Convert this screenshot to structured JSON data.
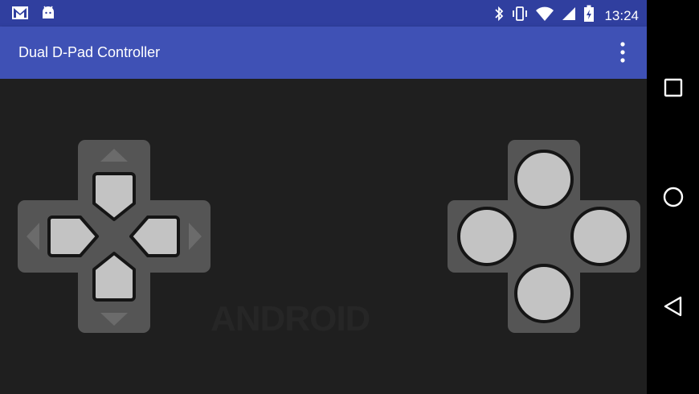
{
  "status_bar": {
    "left_icons": [
      "gmail-icon",
      "android-icon"
    ],
    "right_icons": [
      "bluetooth-icon",
      "vibrate-icon",
      "wifi-icon",
      "cell-signal-icon",
      "battery-charging-icon"
    ],
    "time": "13:24"
  },
  "app_bar": {
    "title": "Dual D-Pad Controller",
    "menu_icon": "overflow-menu-icon",
    "color": "#3f51b5",
    "status_color": "#303f9f"
  },
  "left_pad": {
    "type": "directional-pad",
    "buttons": [
      "up",
      "down",
      "left",
      "right"
    ]
  },
  "right_pad": {
    "type": "face-buttons",
    "buttons": [
      "top",
      "bottom",
      "left",
      "right"
    ]
  },
  "watermark": "ANDROID",
  "nav_bar": {
    "buttons": [
      "recents-icon",
      "home-icon",
      "back-icon"
    ]
  },
  "colors": {
    "background": "#1f1f1f",
    "pad_body": "#555555",
    "pad_button": "#c3c3c3",
    "pad_outline": "#151515"
  }
}
